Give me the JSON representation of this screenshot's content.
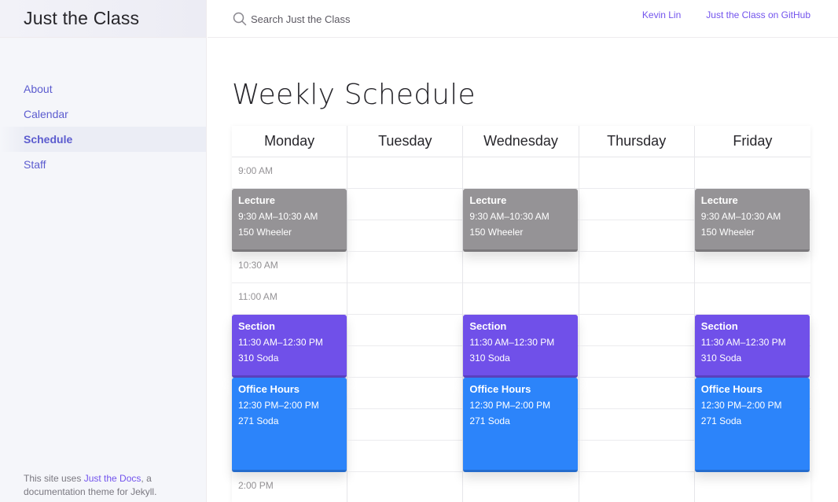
{
  "site": {
    "title": "Just the Class"
  },
  "sidebar": {
    "items": [
      {
        "label": "About",
        "active": false
      },
      {
        "label": "Calendar",
        "active": false
      },
      {
        "label": "Schedule",
        "active": true
      },
      {
        "label": "Staff",
        "active": false
      }
    ],
    "footer": {
      "prefix": "This site uses ",
      "link_text": "Just the Docs",
      "suffix": ", a documentation theme for Jekyll."
    }
  },
  "topbar": {
    "search_placeholder": "Search Just the Class",
    "search_icon": "search-icon",
    "links": [
      {
        "label": "Kevin Lin"
      },
      {
        "label": "Just the Class on GitHub"
      }
    ]
  },
  "main": {
    "title": "Weekly Schedule"
  },
  "schedule": {
    "days": [
      "Monday",
      "Tuesday",
      "Wednesday",
      "Thursday",
      "Friday"
    ],
    "time_labels": [
      "9:00 AM",
      "",
      "",
      "10:30 AM",
      "11:00 AM",
      "",
      "",
      "",
      "",
      "",
      "2:00 PM"
    ],
    "events": {
      "Monday": [
        {
          "type": "lecture",
          "title": "Lecture",
          "time": "9:30 AM–10:30 AM",
          "location": "150 Wheeler"
        },
        {
          "type": "section",
          "title": "Section",
          "time": "11:30 AM–12:30 PM",
          "location": "310 Soda"
        },
        {
          "type": "office",
          "title": "Office Hours",
          "time": "12:30 PM–2:00 PM",
          "location": "271 Soda"
        }
      ],
      "Tuesday": [],
      "Wednesday": [
        {
          "type": "lecture",
          "title": "Lecture",
          "time": "9:30 AM–10:30 AM",
          "location": "150 Wheeler"
        },
        {
          "type": "section",
          "title": "Section",
          "time": "11:30 AM–12:30 PM",
          "location": "310 Soda"
        },
        {
          "type": "office",
          "title": "Office Hours",
          "time": "12:30 PM–2:00 PM",
          "location": "271 Soda"
        }
      ],
      "Thursday": [],
      "Friday": [
        {
          "type": "lecture",
          "title": "Lecture",
          "time": "9:30 AM–10:30 AM",
          "location": "150 Wheeler"
        },
        {
          "type": "section",
          "title": "Section",
          "time": "11:30 AM–12:30 PM",
          "location": "310 Soda"
        },
        {
          "type": "office",
          "title": "Office Hours",
          "time": "12:30 PM–2:00 PM",
          "location": "271 Soda"
        }
      ]
    },
    "colors": {
      "lecture": "#959396",
      "section": "#7050e9",
      "office": "#2c84fa"
    }
  }
}
